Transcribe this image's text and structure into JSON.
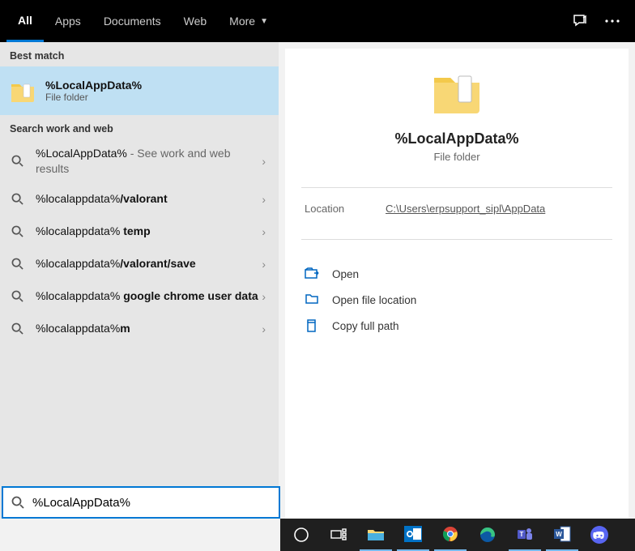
{
  "tabs": {
    "all": "All",
    "apps": "Apps",
    "documents": "Documents",
    "web": "Web",
    "more": "More"
  },
  "sections": {
    "best_match": "Best match",
    "search_work_web": "Search work and web"
  },
  "best": {
    "title": "%LocalAppData%",
    "subtitle": "File folder"
  },
  "results": [
    {
      "prefix": "%LocalAppData%",
      "suffix": "",
      "desc": " - See work and web results",
      "prefix_bold": false
    },
    {
      "prefix": "%localappdata%",
      "suffix": "/valorant",
      "desc": "",
      "prefix_bold": false
    },
    {
      "prefix": "%localappdata% ",
      "suffix": "temp",
      "desc": "",
      "prefix_bold": false
    },
    {
      "prefix": "%localappdata%",
      "suffix": "/valorant/save",
      "desc": "",
      "prefix_bold": false
    },
    {
      "prefix": "%localappdata% ",
      "suffix": "google chrome user data",
      "desc": "",
      "prefix_bold": false
    },
    {
      "prefix": "%localappdata%",
      "suffix": "m",
      "desc": "",
      "prefix_bold": false
    }
  ],
  "preview": {
    "title": "%LocalAppData%",
    "subtitle": "File folder",
    "location_label": "Location",
    "location_value": "C:\\Users\\erpsupport_sipl\\AppData"
  },
  "actions": {
    "open": "Open",
    "open_location": "Open file location",
    "copy_path": "Copy full path"
  },
  "search": {
    "value": "%LocalAppData%"
  },
  "icons": {
    "feedback": "feedback-icon",
    "more": "more-icon"
  },
  "taskbar": [
    "cortana",
    "task-view",
    "explorer",
    "outlook",
    "chrome",
    "edge",
    "teams",
    "word",
    "discord"
  ]
}
